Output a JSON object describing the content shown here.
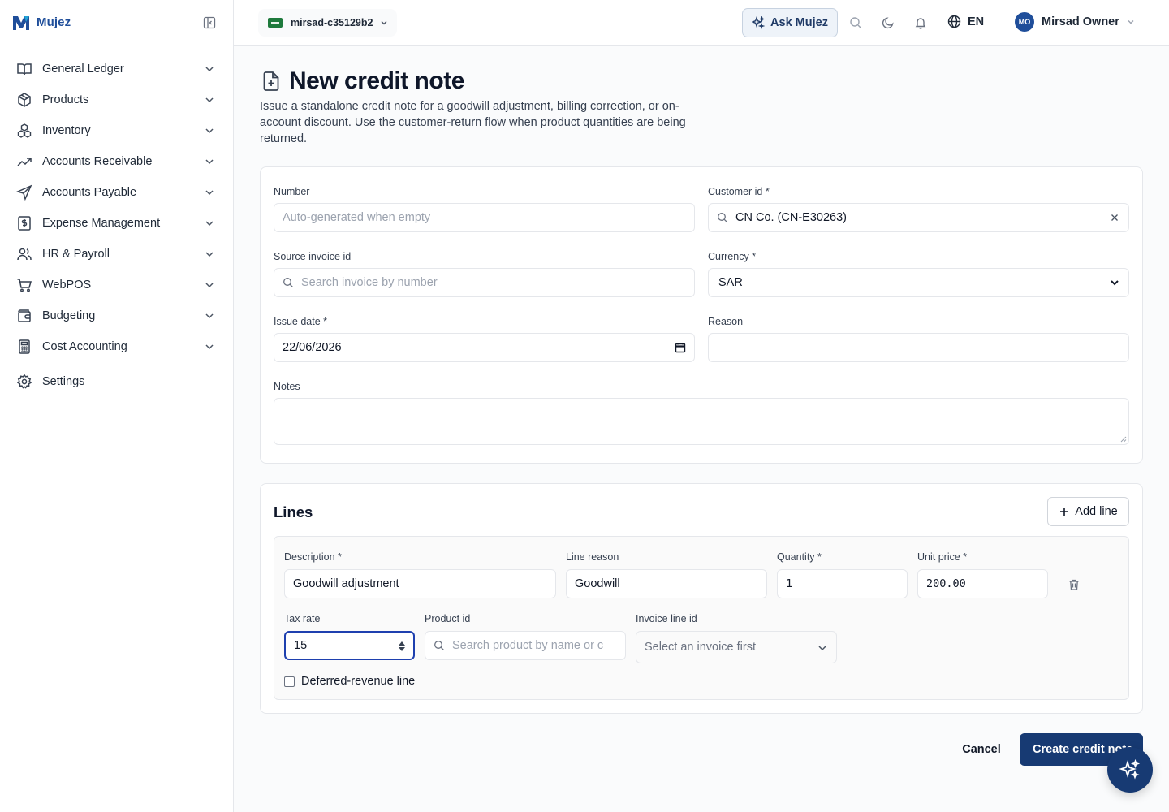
{
  "brand": {
    "name": "Mujez"
  },
  "sidebar": {
    "items": [
      {
        "label": "General Ledger",
        "icon": "book-open-icon"
      },
      {
        "label": "Products",
        "icon": "package-icon"
      },
      {
        "label": "Inventory",
        "icon": "boxes-icon"
      },
      {
        "label": "Accounts Receivable",
        "icon": "trending-up-icon"
      },
      {
        "label": "Accounts Payable",
        "icon": "send-icon"
      },
      {
        "label": "Expense Management",
        "icon": "receipt-icon"
      },
      {
        "label": "HR & Payroll",
        "icon": "users-icon"
      },
      {
        "label": "WebPOS",
        "icon": "cart-icon"
      },
      {
        "label": "Budgeting",
        "icon": "wallet-icon"
      },
      {
        "label": "Cost Accounting",
        "icon": "calculator-icon"
      }
    ],
    "settings_label": "Settings"
  },
  "topbar": {
    "org_name": "mirsad-c35129b2",
    "ask_label": "Ask Mujez",
    "language": "EN",
    "user_initials": "MO",
    "user_name": "Mirsad Owner"
  },
  "page": {
    "title": "New credit note",
    "description": "Issue a standalone credit note for a goodwill adjustment, billing correction, or on-account discount. Use the customer-return flow when product quantities are being returned."
  },
  "form": {
    "number": {
      "label": "Number",
      "placeholder": "Auto-generated when empty",
      "value": ""
    },
    "customer": {
      "label": "Customer id *",
      "value": "CN Co. (CN-E30263)"
    },
    "source_invoice": {
      "label": "Source invoice id",
      "placeholder": "Search invoice by number"
    },
    "currency": {
      "label": "Currency *",
      "value": "SAR"
    },
    "issue_date": {
      "label": "Issue date *",
      "value": "22/06/2026"
    },
    "reason": {
      "label": "Reason",
      "value": ""
    },
    "notes": {
      "label": "Notes",
      "value": ""
    }
  },
  "lines": {
    "title": "Lines",
    "add_label": "Add line",
    "items": [
      {
        "description_label": "Description *",
        "description": "Goodwill adjustment",
        "line_reason_label": "Line reason",
        "line_reason": "Goodwill",
        "quantity_label": "Quantity *",
        "quantity": "1",
        "unit_price_label": "Unit price *",
        "unit_price": "200.00",
        "tax_rate_label": "Tax rate",
        "tax_rate": "15",
        "product_label": "Product id",
        "product_placeholder": "Search product by name or c",
        "invoice_line_label": "Invoice line id",
        "invoice_line_placeholder": "Select an invoice first",
        "deferred_label": "Deferred-revenue line",
        "deferred_checked": false
      }
    ]
  },
  "actions": {
    "cancel_label": "Cancel",
    "create_label": "Create credit note"
  },
  "colors": {
    "brand": "#1f4e9a",
    "primary": "#173a73",
    "focus": "#1e40af"
  }
}
